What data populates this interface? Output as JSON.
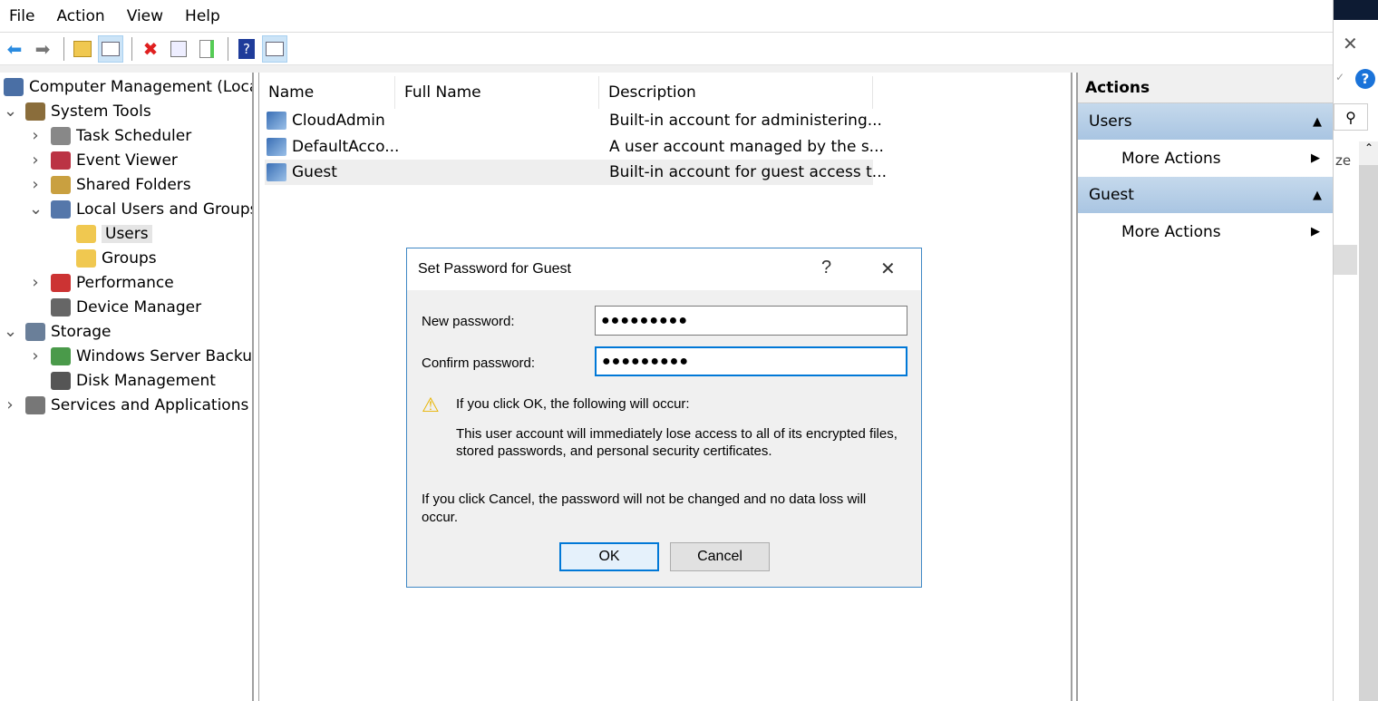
{
  "menu": [
    "File",
    "Action",
    "View",
    "Help"
  ],
  "toolbar": {
    "icons": [
      "back-arrow-icon",
      "forward-arrow-icon",
      "up-folder-icon",
      "show-hide-console-tree-icon",
      "delete-icon",
      "properties-icon",
      "export-list-icon",
      "help-icon",
      "show-hide-action-pane-icon"
    ]
  },
  "tree": [
    {
      "label": "Computer Management (Local",
      "level": 0,
      "chev": ""
    },
    {
      "label": "System Tools",
      "level": 0,
      "chev": "v"
    },
    {
      "label": "Task Scheduler",
      "level": 1,
      "chev": ">"
    },
    {
      "label": "Event Viewer",
      "level": 1,
      "chev": ">"
    },
    {
      "label": "Shared Folders",
      "level": 1,
      "chev": ">"
    },
    {
      "label": "Local Users and Groups",
      "level": 1,
      "chev": "v"
    },
    {
      "label": "Users",
      "level": 2,
      "chev": "",
      "selected": true
    },
    {
      "label": "Groups",
      "level": 2,
      "chev": ""
    },
    {
      "label": "Performance",
      "level": 1,
      "chev": ">"
    },
    {
      "label": "Device Manager",
      "level": 1,
      "chev": ""
    },
    {
      "label": "Storage",
      "level": 0,
      "chev": "v"
    },
    {
      "label": "Windows Server Backup",
      "level": 1,
      "chev": ">"
    },
    {
      "label": "Disk Management",
      "level": 1,
      "chev": ""
    },
    {
      "label": "Services and Applications",
      "level": 0,
      "chev": ">"
    }
  ],
  "list": {
    "columns": [
      "Name",
      "Full Name",
      "Description"
    ],
    "rows": [
      {
        "name": "CloudAdmin",
        "full_name": "",
        "description": "Built-in account for administering..."
      },
      {
        "name": "DefaultAcco...",
        "full_name": "",
        "description": "A user account managed by the s..."
      },
      {
        "name": "Guest",
        "full_name": "",
        "description": "Built-in account for guest access t..."
      }
    ]
  },
  "actions": {
    "title": "Actions",
    "sections": [
      {
        "label": "Users",
        "item": "More Actions"
      },
      {
        "label": "Guest",
        "item": "More Actions"
      }
    ]
  },
  "dialog": {
    "title": "Set Password for Guest",
    "help": "?",
    "close": "✕",
    "new_password_label": "New password:",
    "new_password_value": "●●●●●●●●●",
    "confirm_password_label": "Confirm password:",
    "confirm_password_value": "●●●●●●●●●",
    "warning_title": "If you click OK, the following will occur:",
    "warning_body": "This user account will immediately lose access to all of its encrypted files, stored passwords, and personal security certificates.",
    "cancel_note": "If you click Cancel, the password will not be changed and no data loss will occur.",
    "ok": "OK",
    "cancel": "Cancel"
  },
  "background_window": {
    "partial_text": "ze"
  }
}
